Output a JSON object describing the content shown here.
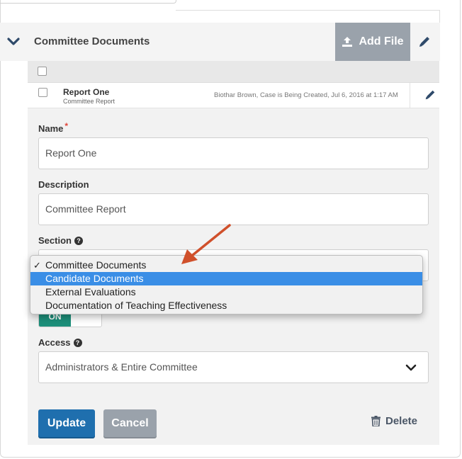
{
  "header": {
    "title": "Committee Documents",
    "add_file_label": "Add File"
  },
  "table": {
    "rows": [
      {
        "title": "Report One",
        "subtitle": "Committee Report",
        "meta": "Biothar Brown, Case is Being Created, Jul 6, 2016 at 1:17 AM"
      }
    ]
  },
  "form": {
    "name_label": "Name",
    "required_mark": "*",
    "name_value": "Report One",
    "description_label": "Description",
    "description_value": "Committee Report",
    "section_label": "Section",
    "toggle_on_label": "ON",
    "access_label": "Access",
    "access_value": "Administrators & Entire Committee",
    "update_label": "Update",
    "cancel_label": "Cancel",
    "delete_label": "Delete"
  },
  "section_dropdown": {
    "checkmark": "✓",
    "options": [
      "Committee Documents",
      "Candidate Documents",
      "External Evaluations",
      "Documentation of Teaching Effectiveness"
    ],
    "checked_index": 0,
    "highlighted_index": 1
  },
  "colors": {
    "primary_button": "#1f6fae",
    "secondary_button": "#9aa2ab",
    "toggle_on": "#1d8f7a",
    "highlight": "#3a8ee6",
    "annotation_arrow": "#d0502b",
    "required": "#e0453a"
  },
  "icons": {
    "collapse": "chevron-down-icon",
    "add_file": "upload-icon",
    "edit": "pencil-icon",
    "help": "question-circle-icon",
    "select": "chevron-down-icon",
    "delete": "trash-icon"
  }
}
